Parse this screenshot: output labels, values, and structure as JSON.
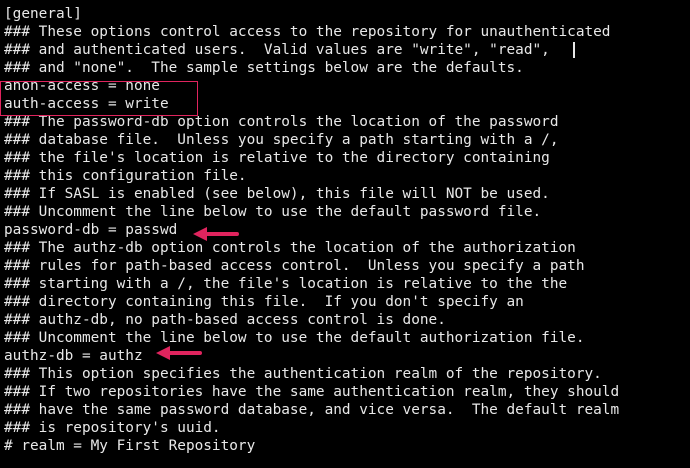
{
  "terminal": {
    "lines": [
      "[general]",
      "### These options control access to the repository for unauthenticated",
      "### and authenticated users.  Valid values are \"write\", \"read\",",
      "### and \"none\".  The sample settings below are the defaults.",
      "anon-access = none",
      "auth-access = write",
      "### The password-db option controls the location of the password",
      "### database file.  Unless you specify a path starting with a /,",
      "### the file's location is relative to the directory containing",
      "### this configuration file.",
      "### If SASL is enabled (see below), this file will NOT be used.",
      "### Uncomment the line below to use the default password file.",
      "password-db = passwd",
      "### The authz-db option controls the location of the authorization",
      "### rules for path-based access control.  Unless you specify a path",
      "### starting with a /, the file's location is relative to the the",
      "### directory containing this file.  If you don't specify an",
      "### authz-db, no path-based access control is done.",
      "### Uncomment the line below to use the default authorization file.",
      "authz-db = authz",
      "### This option specifies the authentication realm of the repository.",
      "### If two repositories have the same authentication realm, they should",
      "### have the same password database, and vice versa.  The default realm",
      "### is repository's uuid.",
      "# realm = My First Repository"
    ]
  },
  "colors": {
    "background": "#000000",
    "text": "#e8e8e8",
    "annotation": "#e0245e"
  }
}
